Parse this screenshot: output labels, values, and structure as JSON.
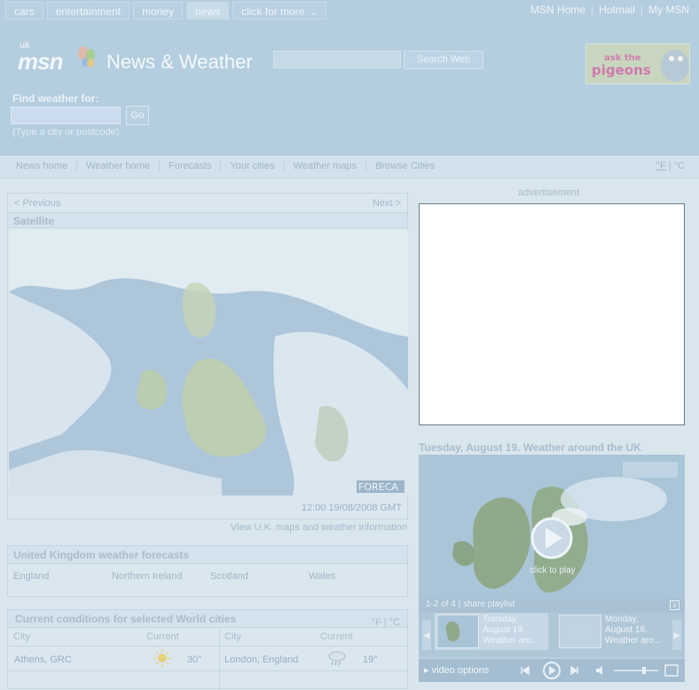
{
  "topnav": {
    "tabs": [
      "cars",
      "entertainment",
      "money",
      "news",
      "click for more"
    ],
    "active_index": 3
  },
  "toplinks": [
    "MSN Home",
    "Hotmail",
    "My MSN"
  ],
  "brand": {
    "region": "uk",
    "logo": "msn"
  },
  "site_title": "News & Weather",
  "search": {
    "value": "",
    "button": "Search Web"
  },
  "header_ad": {
    "line1": "ask the",
    "line2": "pigeons"
  },
  "find_weather": {
    "label": "Find weather for:",
    "value": "",
    "button": "Go",
    "hint": "(Type a city or postcode)"
  },
  "subnav": {
    "items": [
      "News home",
      "Weather home",
      "Forecasts",
      "Your cities",
      "Weather maps",
      "Browse Cities"
    ],
    "unit_f": "°F",
    "unit_sep": "|",
    "unit_c": "°C"
  },
  "satellite": {
    "prev": "< Previous",
    "next": "Next >",
    "title": "Satellite",
    "credit": "FORECA",
    "timestamp": "12:00 19/08/2008 GMT",
    "view_link": "View U.K. maps and weather information"
  },
  "uk_forecasts": {
    "title": "United Kingdom weather forecasts",
    "regions": [
      "England",
      "Northern Ireland",
      "Scotland",
      "Wales"
    ]
  },
  "world_cities": {
    "title": "Current conditions for selected World cities",
    "units": "°F | °C",
    "headers": [
      "City",
      "Current",
      "City",
      "Current"
    ],
    "rows": [
      {
        "city1": "Athens, GRC",
        "icon1": "sun-icon",
        "temp1": "30°",
        "city2": "London, England",
        "icon2": "rain-cloud-icon",
        "temp2": "19°"
      }
    ]
  },
  "advertisement_label": "advertisement",
  "video": {
    "title": "Tuesday, August 19. Weather around the UK",
    "play_caption": "click to play",
    "playlist_count": "1-2 of 4",
    "share_label": "share playlist",
    "close": "x",
    "items": [
      {
        "line1": "Tuesday,",
        "line2": "August 19.",
        "line3": "Weather aro..."
      },
      {
        "line1": "Monday,",
        "line2": "August 18.",
        "line3": "Weather aro..."
      }
    ],
    "options_label": "video options"
  },
  "colors": {
    "header_bg": "#b4cddf",
    "page_bg": "#d9e6ee",
    "text_muted": "#8ea6b8",
    "ad_border": "#6d7a84"
  }
}
